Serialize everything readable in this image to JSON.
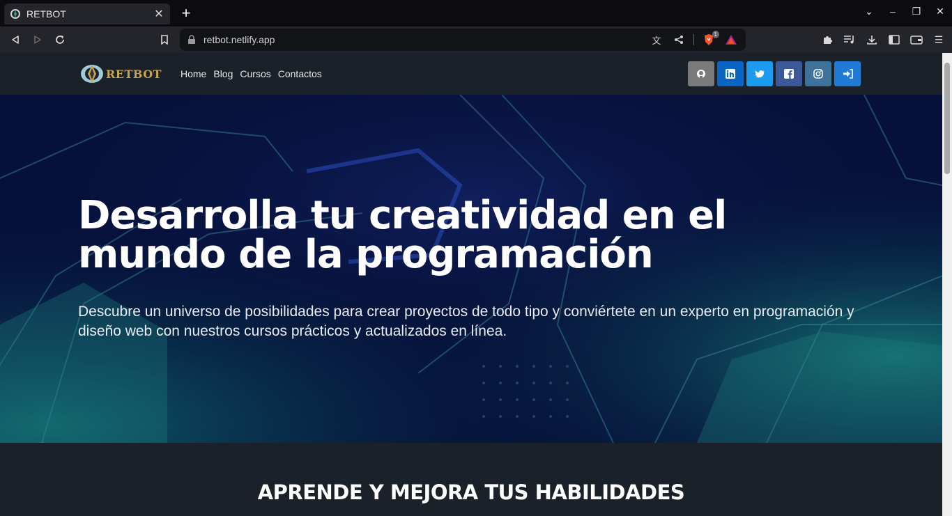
{
  "browser": {
    "tab_title": "RETBOT",
    "url": "retbot.netlify.app",
    "brave_badge_count": "1"
  },
  "navbar": {
    "brand": "RETBOT",
    "links": [
      "Home",
      "Blog",
      "Cursos",
      "Contactos"
    ],
    "socials": [
      {
        "icon": "github-icon",
        "color": "#7a7a7a"
      },
      {
        "icon": "linkedin-icon",
        "color": "#0a66c2"
      },
      {
        "icon": "twitter-icon",
        "color": "#1d9bf0"
      },
      {
        "icon": "facebook-icon",
        "color": "#3b5998"
      },
      {
        "icon": "instagram-icon",
        "color": "#3f729b"
      },
      {
        "icon": "login-icon",
        "color": "#1f7bd6"
      }
    ]
  },
  "hero": {
    "title": "Desarrolla tu creatividad en el mundo de la programación",
    "subtitle": "Descubre un universo de posibilidades para crear proyectos de todo tipo y conviértete en un experto en programación y diseño web con nuestros cursos prácticos y actualizados en línea."
  },
  "section": {
    "heading": "APRENDE Y MEJORA TUS HABILIDADES"
  }
}
